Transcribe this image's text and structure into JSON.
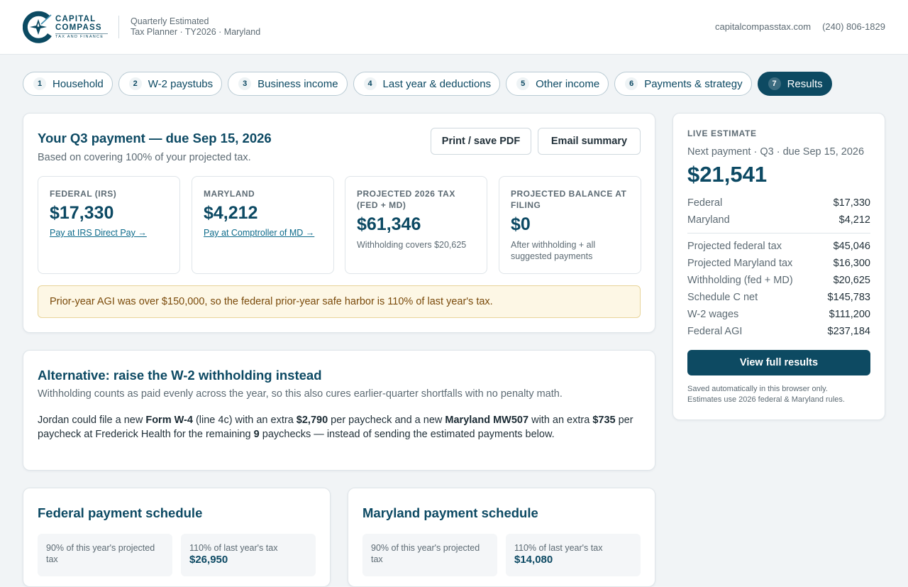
{
  "brand": {
    "name_line1": "CAPITAL",
    "name_line2": "COMPASS",
    "tagline": "TAX AND FINANCE",
    "color": "#0b4a62"
  },
  "header": {
    "subtitle_line1": "Quarterly Estimated",
    "subtitle_line2": "Tax Planner · TY2026 · Maryland",
    "website": "capitalcompasstax.com",
    "phone": "(240) 806-1829"
  },
  "steps": [
    {
      "num": "1",
      "label": "Household"
    },
    {
      "num": "2",
      "label": "W-2 paystubs"
    },
    {
      "num": "3",
      "label": "Business income"
    },
    {
      "num": "4",
      "label": "Last year & deductions"
    },
    {
      "num": "5",
      "label": "Other income"
    },
    {
      "num": "6",
      "label": "Payments & strategy"
    },
    {
      "num": "7",
      "label": "Results",
      "active": true
    }
  ],
  "q3": {
    "title": "Your Q3 payment — due Sep 15, 2026",
    "subtitle": "Based on covering 100% of your projected tax.",
    "print_label": "Print / save PDF",
    "email_label": "Email summary",
    "tiles": {
      "federal": {
        "label": "FEDERAL (IRS)",
        "value": "$17,330",
        "link": "Pay at IRS Direct Pay →"
      },
      "maryland": {
        "label": "MARYLAND",
        "value": "$4,212",
        "link": "Pay at Comptroller of MD →"
      },
      "projected": {
        "label": "PROJECTED 2026 TAX (FED + MD)",
        "value": "$61,346",
        "note": "Withholding covers $20,625"
      },
      "balance": {
        "label": "PROJECTED BALANCE AT FILING",
        "value": "$0",
        "note": "After withholding + all suggested payments"
      }
    },
    "warning": "Prior-year AGI was over $150,000, so the federal prior-year safe harbor is 110% of last year's tax."
  },
  "alternative": {
    "title": "Alternative: raise the W-2 withholding instead",
    "subtitle": "Withholding counts as paid evenly across the year, so this also cures earlier-quarter shortfalls with no penalty math.",
    "p1": "Jordan could file a new ",
    "form_w4": "Form W-4",
    "p2": " (line 4c) with an extra ",
    "extra_fed": "$2,790",
    "p3": " per paycheck and a new ",
    "form_md": "Maryland MW507",
    "p4": " with an extra ",
    "extra_md": "$735",
    "p5": " per paycheck at Frederick Health for the remaining ",
    "paychecks": "9",
    "p6": " paychecks — instead of sending the estimated payments below."
  },
  "federal_schedule": {
    "title": "Federal payment schedule",
    "box1_label": "90% of this year's projected tax",
    "box1_value": "",
    "box2_label": "110% of last year's tax",
    "box2_value": "$26,950"
  },
  "maryland_schedule": {
    "title": "Maryland payment schedule",
    "box1_label": "90% of this year's projected tax",
    "box1_value": "",
    "box2_label": "110% of last year's tax",
    "box2_value": "$14,080"
  },
  "live": {
    "eyebrow": "LIVE ESTIMATE",
    "next_label": "Next payment · Q3 · due Sep 15, 2026",
    "next_value": "$21,541",
    "top_rows": [
      {
        "label": "Federal",
        "value": "$17,330"
      },
      {
        "label": "Maryland",
        "value": "$4,212"
      }
    ],
    "rows": [
      {
        "label": "Projected federal tax",
        "value": "$45,046"
      },
      {
        "label": "Projected Maryland tax",
        "value": "$16,300"
      },
      {
        "label": "Withholding (fed + MD)",
        "value": "$20,625"
      },
      {
        "label": "Schedule C net",
        "value": "$145,783"
      },
      {
        "label": "W-2 wages",
        "value": "$111,200"
      },
      {
        "label": "Federal AGI",
        "value": "$237,184"
      }
    ],
    "button_label": "View full results",
    "footer_line1": "Saved automatically in this browser only.",
    "footer_line2": "Estimates use 2026 federal & Maryland rules."
  }
}
